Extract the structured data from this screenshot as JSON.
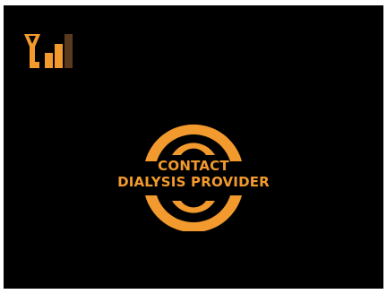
{
  "colors": {
    "screen_background": "#000000",
    "accent": "#f29a2e",
    "signal_inactive": "#5a3a1f"
  },
  "status_bar": {
    "signal_icon": "antenna-signal-icon",
    "signal_bars_active": 3,
    "signal_bars_total": 4
  },
  "alert": {
    "icon": "alert-target-icon",
    "line1": "CONTACT",
    "line2": "DIALYSIS PROVIDER"
  }
}
